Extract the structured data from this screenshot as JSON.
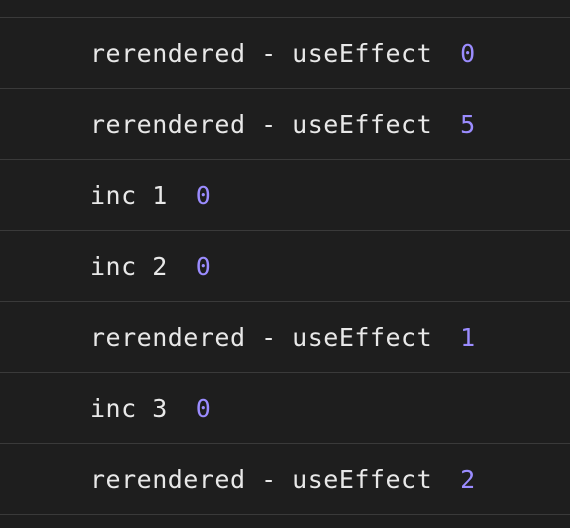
{
  "console": {
    "rows": [
      {
        "text": "rerendered - useEffect",
        "value": "0"
      },
      {
        "text": "rerendered - useEffect",
        "value": "5"
      },
      {
        "text": "inc 1",
        "value": "0"
      },
      {
        "text": "inc 2",
        "value": "0"
      },
      {
        "text": "rerendered - useEffect",
        "value": "1"
      },
      {
        "text": "inc 3",
        "value": "0"
      },
      {
        "text": "rerendered - useEffect",
        "value": "2"
      }
    ]
  }
}
